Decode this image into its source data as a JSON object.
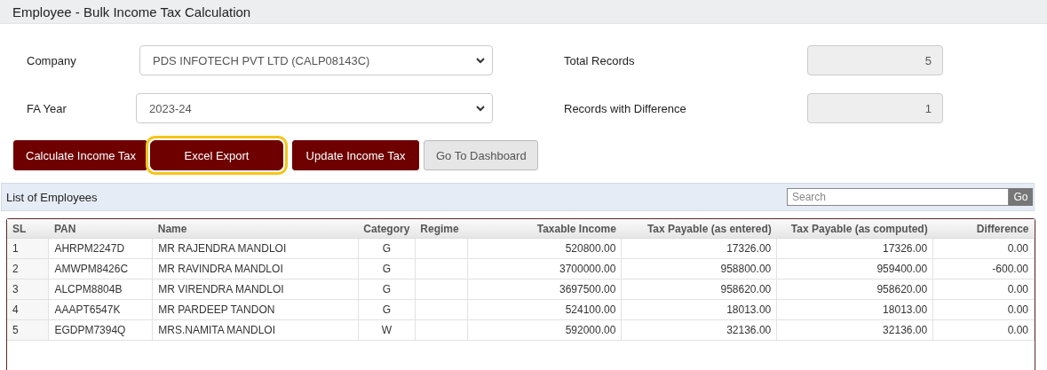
{
  "page_title": "Employee - Bulk Income Tax Calculation",
  "form": {
    "company": {
      "label": "Company",
      "value": "PDS INFOTECH PVT LTD (CALP08143C)"
    },
    "fa_year": {
      "label": "FA Year",
      "value": "2023-24"
    },
    "total_records": {
      "label": "Total Records",
      "value": "5"
    },
    "records_with_difference": {
      "label": "Records with Difference",
      "value": "1"
    }
  },
  "buttons": [
    {
      "label": "Calculate Income Tax",
      "kind": "primary",
      "highlighted": false
    },
    {
      "label": "Excel Export",
      "kind": "primary",
      "highlighted": true
    },
    {
      "label": "Update Income Tax",
      "kind": "primary",
      "highlighted": false
    },
    {
      "label": "Go To Dashboard",
      "kind": "secondary",
      "highlighted": false
    }
  ],
  "panel": {
    "title": "List of Employees",
    "search": {
      "placeholder": "Search",
      "button": "Go"
    }
  },
  "table": {
    "columns": [
      "SL",
      "PAN",
      "Name",
      "Category",
      "Regime",
      "Taxable Income",
      "Tax Payable (as entered)",
      "Tax Payable (as computed)",
      "Difference"
    ],
    "rows": [
      {
        "sl": "1",
        "pan": "AHRPM2247D",
        "name": "MR RAJENDRA MANDLOI",
        "category": "G",
        "taxable_income": "520800.00",
        "tax_entered": "17326.00",
        "tax_computed": "17326.00",
        "difference": "0.00"
      },
      {
        "sl": "2",
        "pan": "AMWPM8426C",
        "name": "MR RAVINDRA MANDLOI",
        "category": "G",
        "taxable_income": "3700000.00",
        "tax_entered": "958800.00",
        "tax_computed": "959400.00",
        "difference": "-600.00"
      },
      {
        "sl": "3",
        "pan": "ALCPM8804B",
        "name": "MR VIRENDRA MANDLOI",
        "category": "G",
        "taxable_income": "3697500.00",
        "tax_entered": "958620.00",
        "tax_computed": "958620.00",
        "difference": "0.00"
      },
      {
        "sl": "4",
        "pan": "AAAPT6547K",
        "name": "MR PARDEEP TANDON",
        "category": "G",
        "taxable_income": "524100.00",
        "tax_entered": "18013.00",
        "tax_computed": "18013.00",
        "difference": "0.00"
      },
      {
        "sl": "5",
        "pan": "EGDPM7394Q",
        "name": "MRS.NAMITA MANDLOI",
        "category": "W",
        "taxable_income": "592000.00",
        "tax_entered": "32136.00",
        "tax_computed": "32136.00",
        "difference": "0.00"
      }
    ]
  }
}
